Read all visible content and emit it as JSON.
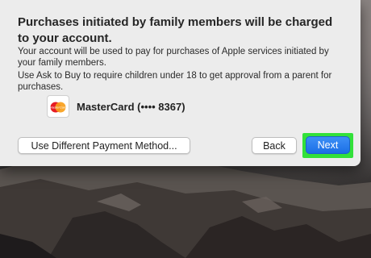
{
  "dialog": {
    "title": "Purchases initiated by family members will be charged to your account.",
    "paragraph_1": "Your account will be used to pay for purchases of Apple services initiated by your family members.",
    "paragraph_2": "Use Ask to Buy to require children under 18 to get approval from a parent for purchases.",
    "card": {
      "icon": "mastercard-logo-icon",
      "logo_text": "MasterCard",
      "label": "MasterCard (•••• 8367)"
    },
    "buttons": {
      "different_payment": "Use Different Payment Method...",
      "back": "Back",
      "next": "Next"
    }
  },
  "colors": {
    "highlight": "#33e13a",
    "next_button": "#1b6fe6",
    "dialog_background": "#ececec"
  }
}
